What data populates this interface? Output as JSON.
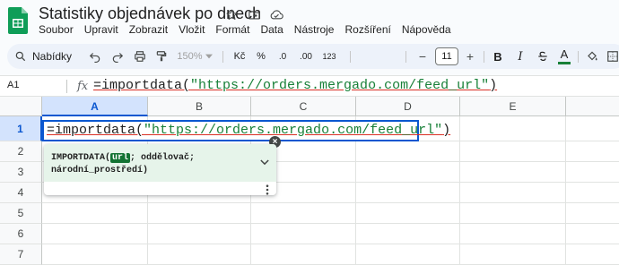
{
  "document": {
    "title": "Statistiky objednávek po dnech"
  },
  "title_icons": [
    "star-icon",
    "move-folder-icon",
    "cloud-status-icon"
  ],
  "menu": {
    "items": [
      "Soubor",
      "Upravit",
      "Zobrazit",
      "Vložit",
      "Formát",
      "Data",
      "Nástroje",
      "Rozšíření",
      "Nápověda"
    ]
  },
  "toolbar": {
    "search_label": "Nabídky",
    "zoom": "150%",
    "currency": "Kč",
    "percent": "%",
    "decrease_decimals": ".0",
    "increase_decimals": ".00",
    "number_format": "123",
    "font_size": "11",
    "minus": "−",
    "plus": "+",
    "bold": "B",
    "text_color_label": "A",
    "text_color": "#188038"
  },
  "formula_bar": {
    "cell_ref": "A1",
    "fx": "fx",
    "func": "=importdata(",
    "arg": "\"https://orders.mergado.com/feed_url\"",
    "close": ")"
  },
  "grid": {
    "columns": [
      "A",
      "B",
      "C",
      "D",
      "E"
    ],
    "rows": [
      "1",
      "2",
      "3",
      "4",
      "5",
      "6",
      "7"
    ],
    "selected_column": "A",
    "selected_row": "1"
  },
  "cell_editor": {
    "func": "=importdata(",
    "arg": "\"https://orders.mergado.com/feed_url\"",
    "close": ")",
    "dismiss": "×"
  },
  "formula_help": {
    "fn_open": "IMPORTDATA(",
    "arg_current": "url",
    "rest_line1": "; oddělovač;",
    "rest_line2": "národní_prostředí)"
  }
}
